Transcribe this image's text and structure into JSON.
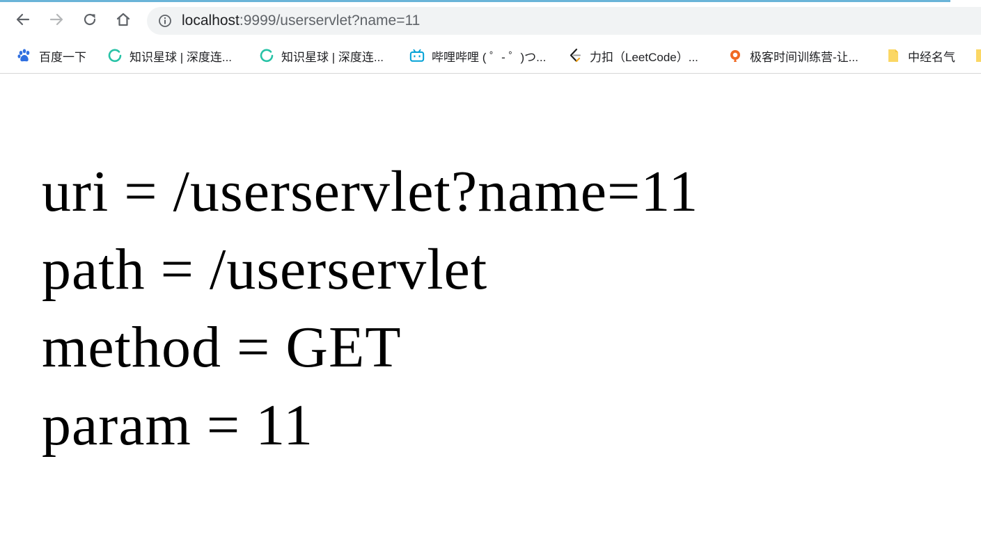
{
  "browser": {
    "address_bar": {
      "host": "localhost",
      "rest": ":9999/userservlet?name=11"
    }
  },
  "bookmarks": [
    {
      "label": "百度一下",
      "icon": "baidu-paw-icon"
    },
    {
      "label": "知识星球 | 深度连...",
      "icon": "zsxq-ring-icon"
    },
    {
      "label": "知识星球 | 深度连...",
      "icon": "zsxq-ring-icon"
    },
    {
      "label": "哔哩哔哩 ( ゜- ゜)つ...",
      "icon": "bilibili-tv-icon"
    },
    {
      "label": "力扣（LeetCode）...",
      "icon": "leetcode-icon"
    },
    {
      "label": "极客时间训练营-让...",
      "icon": "geektime-icon"
    },
    {
      "label": "中经名气",
      "icon": "folder-icon"
    }
  ],
  "page": {
    "lines": [
      "uri = /userservlet?name=11",
      "path = /userservlet",
      "method = GET",
      "param = 11"
    ]
  },
  "colors": {
    "accent_line": "#6ab4d8",
    "omnibox_bg": "#f1f3f4",
    "folder": "#fbd764",
    "zsxq": "#27c2a6",
    "bilibili": "#00a1d6",
    "baidu": "#2f6fe0"
  }
}
